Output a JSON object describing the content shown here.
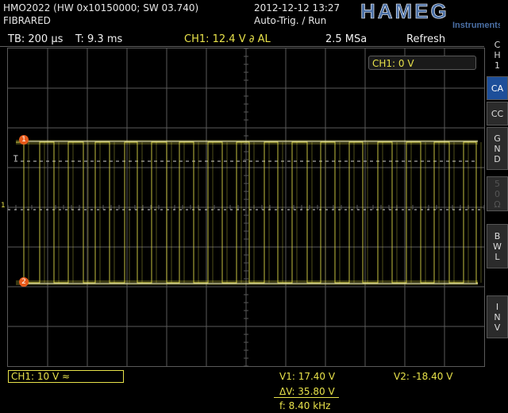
{
  "device": {
    "model_line": "HMO2022 (HW 0x10150000; SW 03.740)",
    "label": "FIBRARED",
    "datetime": "2012-12-12 13:27",
    "mode": "Auto-Trig. / Run"
  },
  "logo": {
    "brand": "HAMEG",
    "sub": "Instruments"
  },
  "status": {
    "timebase": "TB: 200 µs",
    "trigger_time": "T: 9.3 ms",
    "trigger": "CH1: 12.4 V ∂ AL",
    "sample_rate": "2.5 MSa",
    "acquire": "Refresh"
  },
  "overlay": {
    "ch1_badge": "CH1: 0 V"
  },
  "markers": {
    "cursor1": "1",
    "cursor2": "2",
    "channel": "1",
    "trigger_level": "T"
  },
  "sidebar": {
    "title_lines": [
      "C",
      "H",
      "1"
    ],
    "items": [
      {
        "label": "CA",
        "state": "active"
      },
      {
        "label": "CC",
        "state": "normal"
      },
      {
        "label": "GND",
        "state": "normal"
      },
      {
        "label": "50Ω",
        "state": "disabled"
      },
      {
        "label": "BWL",
        "state": "normal"
      },
      {
        "label": "INV",
        "state": "normal"
      }
    ]
  },
  "bottom": {
    "ch1_scale": "CH1: 10 V ≈",
    "v1": "V1: 17.40 V",
    "v2": "V2: -18.40 V",
    "delta_v": "ΔV: 35.80 V",
    "freq": "f: 8.40 kHz"
  },
  "colors": {
    "trace": "#e8e24a",
    "grid": "#5a5a5a",
    "active": "#1d4f9a",
    "logo": "#4a6fa5"
  }
}
